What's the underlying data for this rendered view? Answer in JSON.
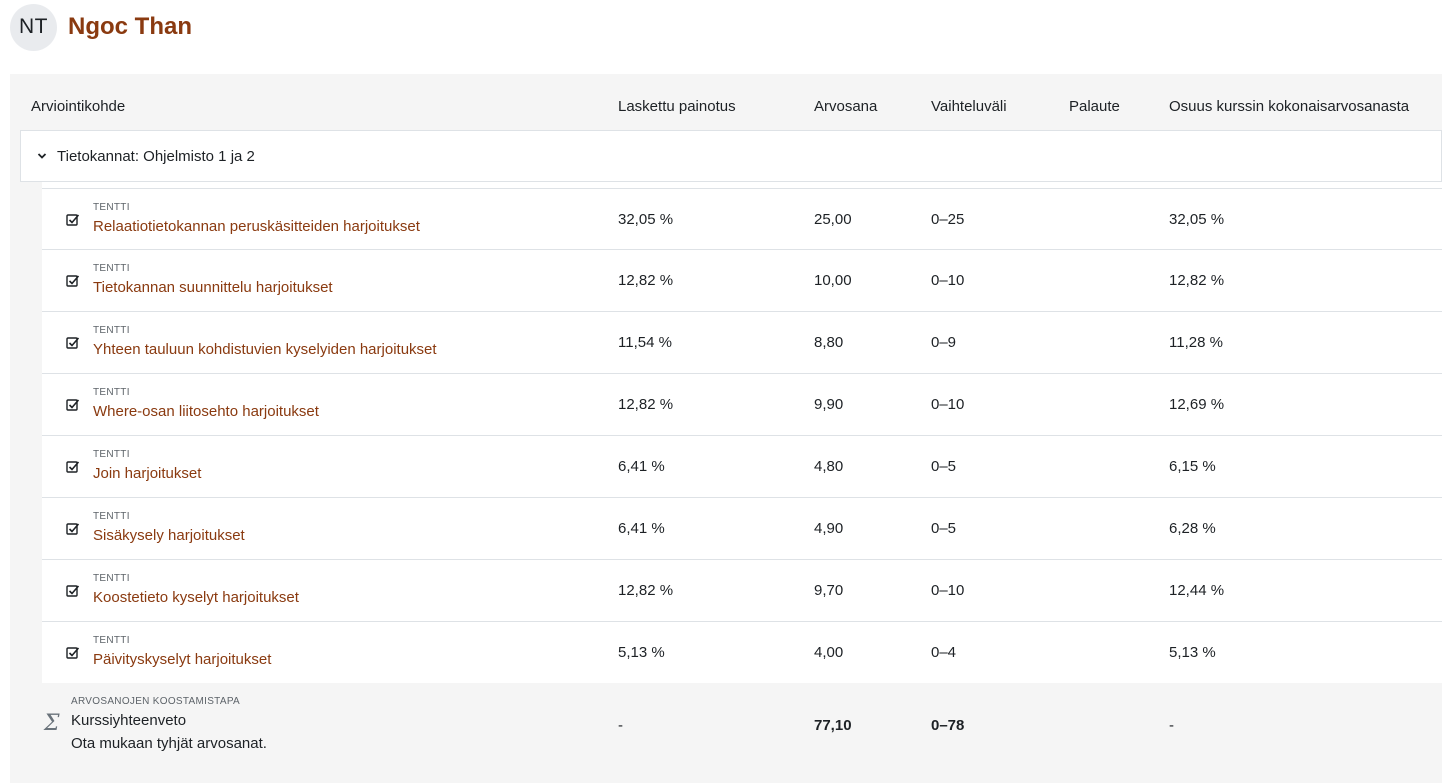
{
  "user": {
    "initials": "NT",
    "name": "Ngoc Than"
  },
  "columns": {
    "item": "Arviointikohde",
    "weight": "Laskettu painotus",
    "grade": "Arvosana",
    "range": "Vaihteluväli",
    "feedback": "Palaute",
    "contribution": "Osuus kurssin kokonaisarvosanasta"
  },
  "category": {
    "title": "Tietokannat: Ohjelmisto 1 ja 2",
    "icon": "chevron-down-icon"
  },
  "items": [
    {
      "type": "TENTTI",
      "name": "Relaatiotietokannan peruskäsitteiden harjoitukset",
      "weight": "32,05 %",
      "grade": "25,00",
      "range": "0–25",
      "feedback": "",
      "contribution": "32,05 %",
      "icon": "quiz-checkbox-icon"
    },
    {
      "type": "TENTTI",
      "name": "Tietokannan suunnittelu harjoitukset",
      "weight": "12,82 %",
      "grade": "10,00",
      "range": "0–10",
      "feedback": "",
      "contribution": "12,82 %",
      "icon": "quiz-checkbox-icon"
    },
    {
      "type": "TENTTI",
      "name": "Yhteen tauluun kohdistuvien kyselyiden harjoitukset",
      "weight": "11,54 %",
      "grade": "8,80",
      "range": "0–9",
      "feedback": "",
      "contribution": "11,28 %",
      "icon": "quiz-checkbox-icon"
    },
    {
      "type": "TENTTI",
      "name": "Where-osan liitosehto harjoitukset",
      "weight": "12,82 %",
      "grade": "9,90",
      "range": "0–10",
      "feedback": "",
      "contribution": "12,69 %",
      "icon": "quiz-checkbox-icon"
    },
    {
      "type": "TENTTI",
      "name": "Join harjoitukset",
      "weight": "6,41 %",
      "grade": "4,80",
      "range": "0–5",
      "feedback": "",
      "contribution": "6,15 %",
      "icon": "quiz-checkbox-icon"
    },
    {
      "type": "TENTTI",
      "name": "Sisäkysely harjoitukset",
      "weight": "6,41 %",
      "grade": "4,90",
      "range": "0–5",
      "feedback": "",
      "contribution": "6,28 %",
      "icon": "quiz-checkbox-icon"
    },
    {
      "type": "TENTTI",
      "name": "Koostetieto kyselyt harjoitukset",
      "weight": "12,82 %",
      "grade": "9,70",
      "range": "0–10",
      "feedback": "",
      "contribution": "12,44 %",
      "icon": "quiz-checkbox-icon"
    },
    {
      "type": "TENTTI",
      "name": "Päivityskyselyt harjoitukset",
      "weight": "5,13 %",
      "grade": "4,00",
      "range": "0–4",
      "feedback": "",
      "contribution": "5,13 %",
      "icon": "quiz-checkbox-icon"
    }
  ],
  "total": {
    "type": "ARVOSANOJEN KOOSTAMISTAPA",
    "title": "Kurssiyhteenveto",
    "subtitle": "Ota mukaan tyhjät arvosanat.",
    "weight": "-",
    "grade": "77,10",
    "range": "0–78",
    "contribution": "-",
    "icon": "sigma-icon"
  },
  "colors": {
    "link": "#8a3a10",
    "background": "#f5f5f5",
    "border": "#dee2e6"
  }
}
